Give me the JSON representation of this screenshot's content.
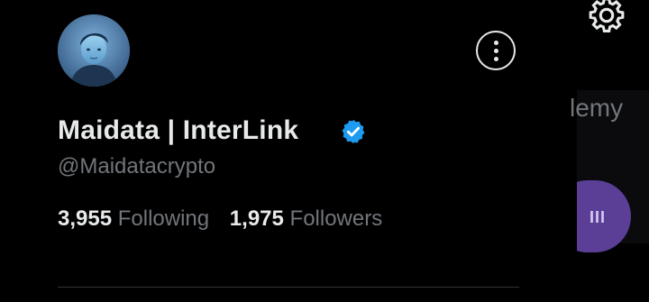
{
  "profile": {
    "display_name": "Maidata | InterLink",
    "handle": "@Maidatacrypto",
    "verified": true,
    "following_count": "3,955",
    "following_label": "Following",
    "followers_count": "1,975",
    "followers_label": "Followers",
    "avatar_icon": "user-avatar",
    "more_icon": "more-options-icon"
  },
  "right_panel": {
    "partial_text": "lemy",
    "button_glyph": "III",
    "settings_icon": "gear-icon"
  },
  "colors": {
    "background": "#000000",
    "primary_text": "#e7e9ea",
    "secondary_text": "#71767b",
    "verified_blue": "#1d9bf0",
    "accent_purple": "#5b3f97",
    "divider": "#2f3336"
  }
}
